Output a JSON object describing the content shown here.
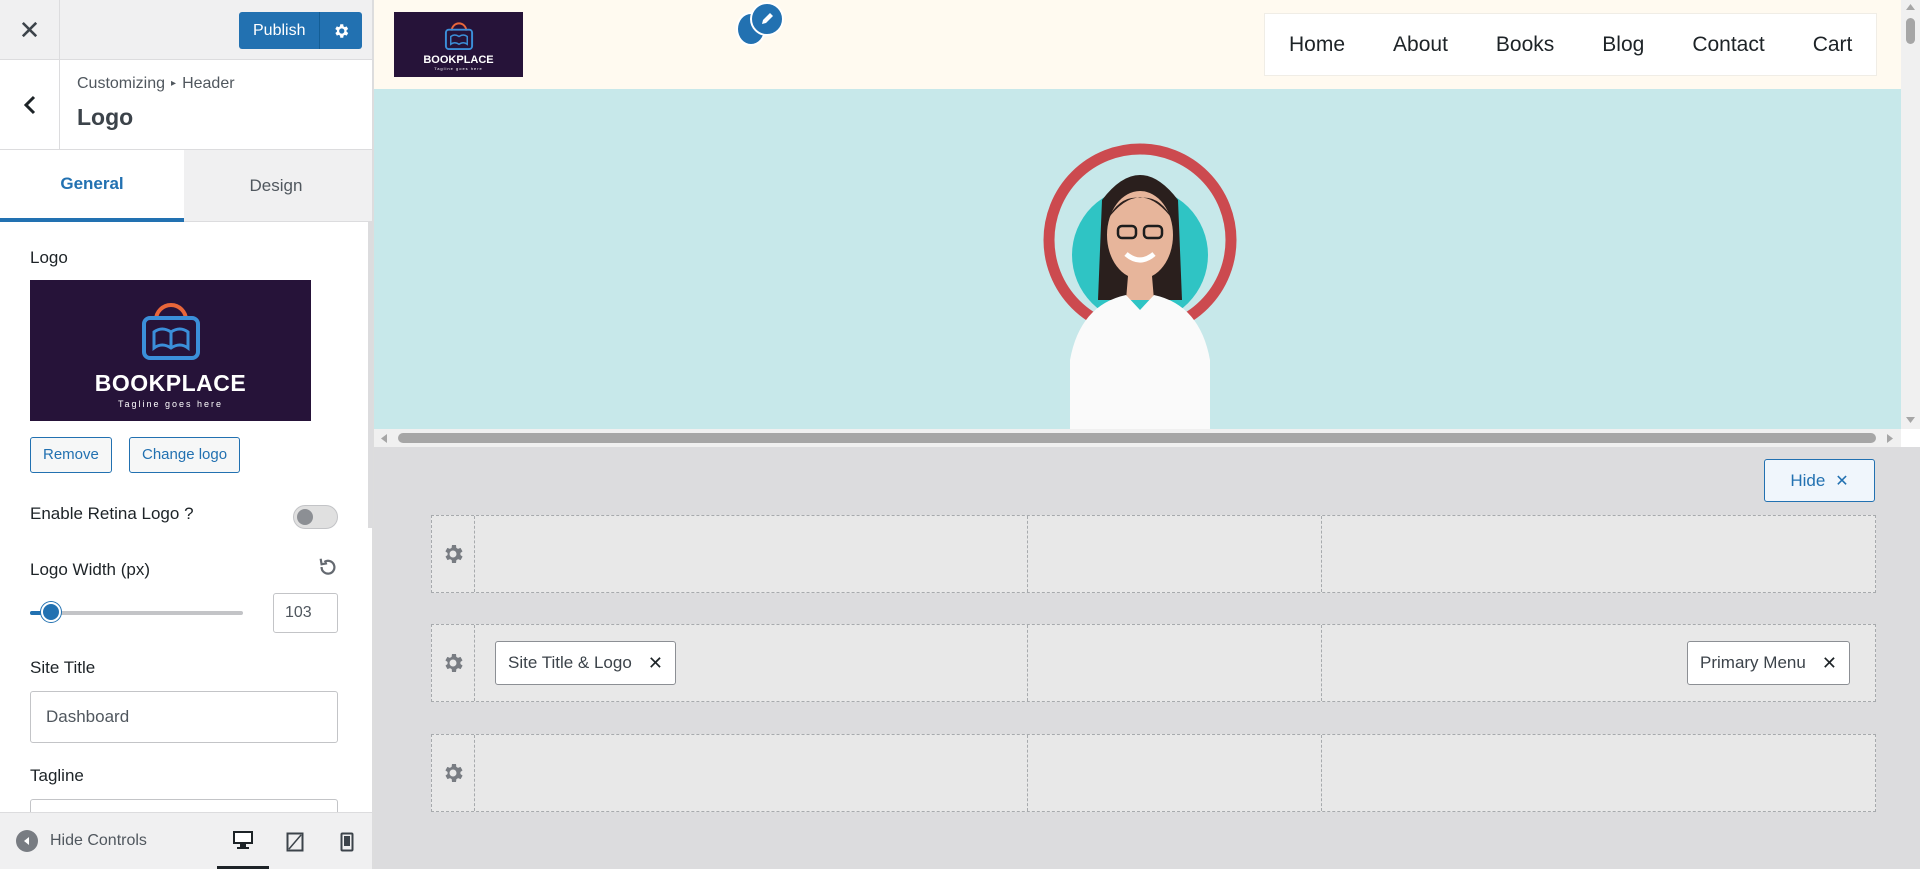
{
  "topbar": {
    "publish_label": "Publish"
  },
  "section": {
    "breadcrumb_root": "Customizing",
    "breadcrumb_sep": "▸",
    "breadcrumb_parent": "Header",
    "title": "Logo"
  },
  "tabs": [
    {
      "label": "General"
    },
    {
      "label": "Design"
    }
  ],
  "controls": {
    "logo_label": "Logo",
    "logo_brand": "BOOKPLACE",
    "logo_tagline": "Tagline goes here",
    "remove_label": "Remove",
    "change_label": "Change logo",
    "retina_label": "Enable Retina Logo ?",
    "retina_enabled": false,
    "width_label": "Logo Width (px)",
    "width_value": "103",
    "width_fraction": 0.1,
    "site_title_label": "Site Title",
    "site_title_value": "Dashboard",
    "tagline_label": "Tagline"
  },
  "footer": {
    "hide_controls_label": "Hide Controls"
  },
  "preview": {
    "nav": [
      {
        "label": "Home"
      },
      {
        "label": "About"
      },
      {
        "label": "Books"
      },
      {
        "label": "Blog"
      },
      {
        "label": "Contact"
      },
      {
        "label": "Cart"
      }
    ],
    "logo_brand": "BOOKPLACE",
    "logo_tagline": "Tagline goes here"
  },
  "builder": {
    "hide_label": "Hide",
    "chip_left": "Site Title & Logo",
    "chip_right": "Primary Menu"
  },
  "colors": {
    "accent": "#2271b1",
    "hero_bg": "#c7e8ea",
    "logo_bg": "#261339",
    "header_bg": "#fffaf0"
  }
}
